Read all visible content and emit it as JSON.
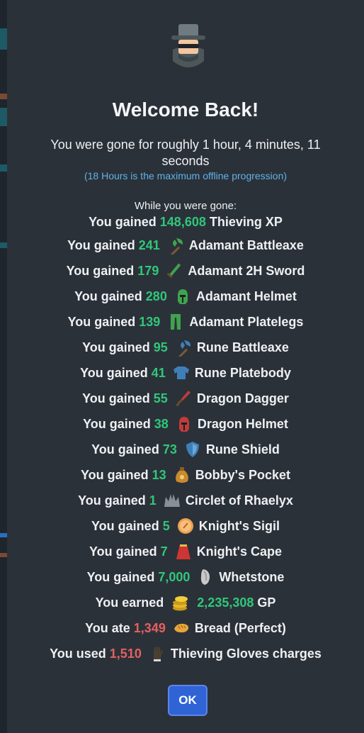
{
  "modal": {
    "title": "Welcome Back!",
    "gone_text": "You were gone for roughly 1 hour, 4 minutes, 11 seconds",
    "max_note": "(18 Hours is the maximum offline progression)",
    "while_gone": "While you were gone:",
    "ok_label": "OK"
  },
  "xp_row": {
    "prefix": "You gained",
    "amount": "148,608",
    "suffix": "Thieving XP"
  },
  "item_rows": [
    {
      "prefix": "You gained",
      "amount": "241",
      "name": "Adamant Battleaxe",
      "icon": "battleaxe-icon",
      "color": "#3fa34d"
    },
    {
      "prefix": "You gained",
      "amount": "179",
      "name": "Adamant 2H Sword",
      "icon": "sword-icon",
      "color": "#3fa34d"
    },
    {
      "prefix": "You gained",
      "amount": "280",
      "name": "Adamant Helmet",
      "icon": "helmet-icon",
      "color": "#3fa34d"
    },
    {
      "prefix": "You gained",
      "amount": "139",
      "name": "Adamant Platelegs",
      "icon": "platelegs-icon",
      "color": "#3fa34d"
    },
    {
      "prefix": "You gained",
      "amount": "95",
      "name": "Rune Battleaxe",
      "icon": "battleaxe-icon",
      "color": "#3f7fb8"
    },
    {
      "prefix": "You gained",
      "amount": "41",
      "name": "Rune Platebody",
      "icon": "platebody-icon",
      "color": "#3f7fb8"
    },
    {
      "prefix": "You gained",
      "amount": "55",
      "name": "Dragon Dagger",
      "icon": "dagger-icon",
      "color": "#c23b3b"
    },
    {
      "prefix": "You gained",
      "amount": "38",
      "name": "Dragon Helmet",
      "icon": "helmet-icon",
      "color": "#c23b3b"
    },
    {
      "prefix": "You gained",
      "amount": "73",
      "name": "Rune Shield",
      "icon": "shield-icon",
      "color": "#3f7fb8"
    },
    {
      "prefix": "You gained",
      "amount": "13",
      "name": "Bobby's Pocket",
      "icon": "pouch-icon",
      "color": "#c98a2e"
    },
    {
      "prefix": "You gained",
      "amount": "1",
      "name": "Circlet of Rhaelyx",
      "icon": "crown-icon",
      "color": "#8a8f96"
    },
    {
      "prefix": "You gained",
      "amount": "5",
      "name": "Knight's Sigil",
      "icon": "sigil-icon",
      "color": "#f0a050"
    },
    {
      "prefix": "You gained",
      "amount": "7",
      "name": "Knight's Cape",
      "icon": "cape-icon",
      "color": "#d03535"
    },
    {
      "prefix": "You gained",
      "amount": "7,000",
      "name": "Whetstone",
      "icon": "whetstone-icon",
      "color": "#c8c8c8"
    }
  ],
  "gp_row": {
    "prefix": "You earned",
    "amount": "2,235,308",
    "suffix": "GP",
    "icon": "coins-icon"
  },
  "spent_rows": [
    {
      "prefix": "You ate",
      "amount": "1,349",
      "name": "Bread (Perfect)",
      "icon": "bread-icon"
    },
    {
      "prefix": "You used",
      "amount": "1,510",
      "name": "Thieving Gloves charges",
      "icon": "gloves-icon"
    }
  ],
  "colors": {
    "gain": "#30c77a",
    "loss": "#e5605f",
    "note": "#5fb3e8",
    "ok_button": "#2f63d6"
  }
}
